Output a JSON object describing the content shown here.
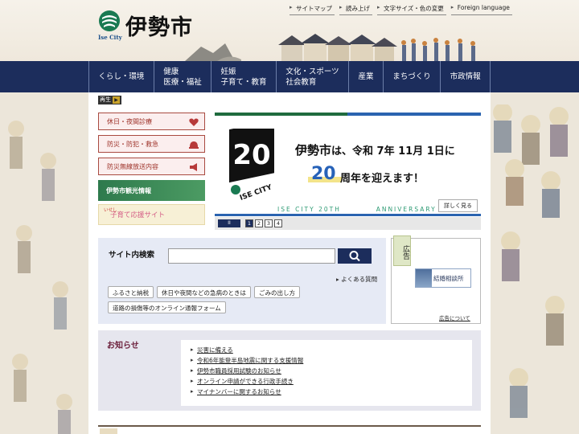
{
  "header": {
    "logo_subtitle": "Ise City",
    "logo_name": "伊勢市",
    "util_links": [
      "サイトマップ",
      "読み上げ",
      "文字サイズ・色の変更",
      "Foreign language"
    ]
  },
  "nav": {
    "items": [
      {
        "label": "くらし・環境"
      },
      {
        "label": "健康\n医療・福祉"
      },
      {
        "label": "妊娠\n子育て・教育"
      },
      {
        "label": "文化・スポーツ\n社会教育"
      },
      {
        "label": "産業"
      },
      {
        "label": "まちづくり"
      },
      {
        "label": "市政情報"
      }
    ]
  },
  "play": {
    "label": "再生"
  },
  "quick_links": [
    {
      "label": "休日・夜間診療",
      "icon": "heart-icon"
    },
    {
      "label": "防災・防犯・救急",
      "icon": "helmet-icon"
    },
    {
      "label": "防災無線放送内容",
      "icon": "megaphone-icon"
    }
  ],
  "banners": {
    "tourism": "伊勢市観光情報",
    "kids_small": "いせし",
    "kids": "子育て応援サイト"
  },
  "slider": {
    "badge_num": "20",
    "badge_text": "ISE CITY",
    "line1_city": "伊勢市",
    "line1_rest": "は、令和 7年 11月 1日に",
    "line2_num": "20",
    "line2_text": "周年を迎えます！",
    "en_left": "ISE CITY 20TH",
    "en_right": "ANNIVERSARY",
    "more": "詳しく見る",
    "pause": "II",
    "pages": [
      "1",
      "2",
      "3",
      "4"
    ]
  },
  "search": {
    "label": "サイト内検索",
    "value": "",
    "placeholder": "",
    "faq": "よくある質問",
    "tags": [
      "ふるさと納税",
      "休日や夜間などの急病のときは",
      "ごみの出し方",
      "道路の損傷等のオンライン通報フォーム"
    ]
  },
  "ad": {
    "tab": "広告",
    "banner": "結婚相談所",
    "about": "広告について"
  },
  "news": {
    "title": "お知らせ",
    "items": [
      "災害に備える",
      "令和6年能登半島地震に関する支援情報",
      "伊勢市職員採用試験のお知らせ",
      "オンライン申請ができる行政手続き",
      "マイナンバーに関するお知らせ"
    ]
  },
  "colors": {
    "nav_bg": "#1c2d5c",
    "accent_red": "#9c2f26",
    "accent_blue": "#2a63b0",
    "accent_green": "#1f6b3e"
  }
}
